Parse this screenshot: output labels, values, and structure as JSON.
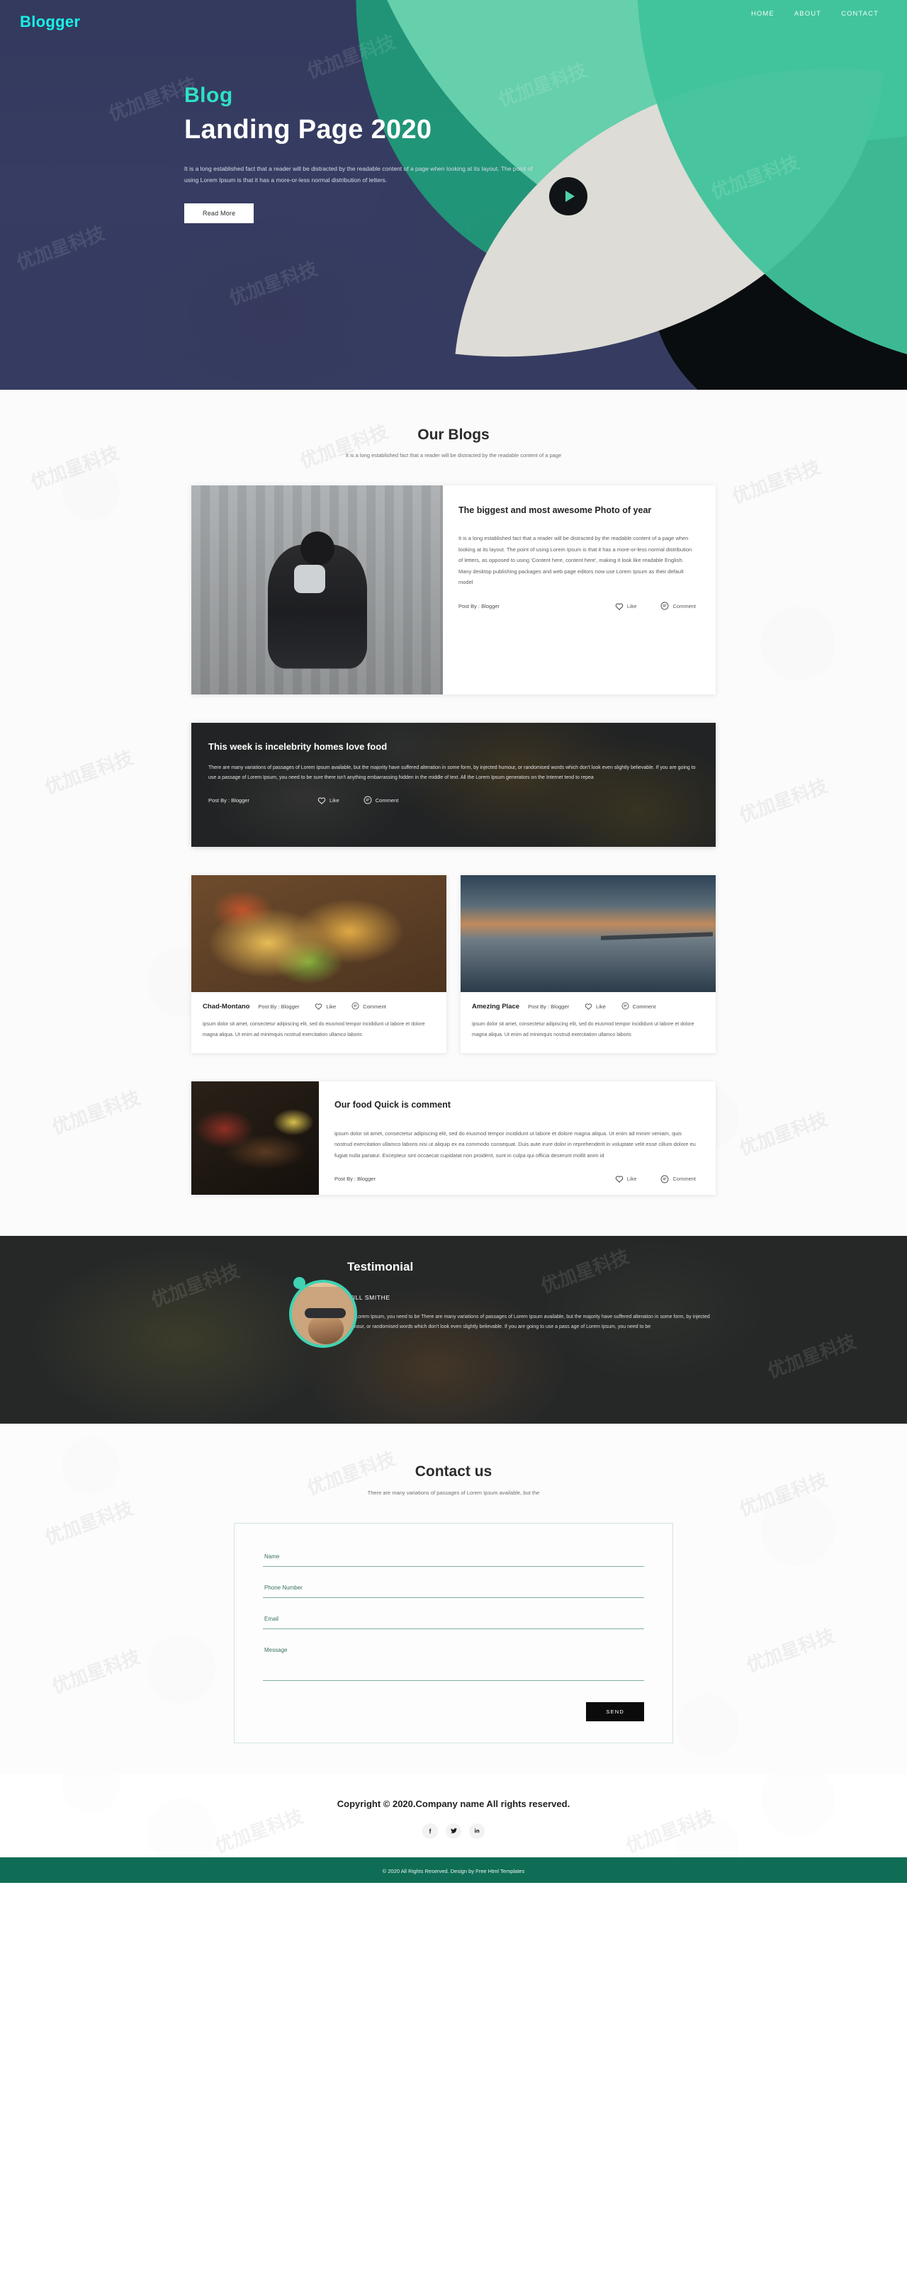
{
  "colors": {
    "accent_teal": "#3fc39b",
    "hero_bg": "#343a5e",
    "brand_cyan": "#18f0e8",
    "footer_green": "#0f6d56"
  },
  "header": {
    "brand": "Blogger",
    "nav": [
      {
        "label": "HOME"
      },
      {
        "label": "ABOUT"
      },
      {
        "label": "CONTACT"
      }
    ]
  },
  "hero": {
    "kicker": "Blog",
    "title": "Landing Page 2020",
    "description": "It is a long established fact that a reader will be distracted by the readable content of a page when looking at its layout. The point of using Lorem Ipsum is that it has a more-or-less normal distribution of letters.",
    "read_more": "Read More",
    "play_icon": "play-icon"
  },
  "blogs": {
    "title": "Our Blogs",
    "subtitle": "It is a long established fact that a reader will be distracted by the readable content of a page",
    "post_by": "Post By : Blogger",
    "like": "Like",
    "comment": "Comment",
    "cards": [
      {
        "title": "The biggest and most awesome Photo of year",
        "text": "It is a long established fact that a reader will be distracted by the readable content of a page when looking at its layout. The point of using Lorem Ipsum is that it has a more-or-less normal distribution of letters, as opposed to using 'Content here, content here', making it look like readable English. Many desktop publishing packages and web page editors now use Lorem Ipsum as their default model"
      },
      {
        "title": "This week is incelebrity homes love food",
        "text": "There are many variations of passages of Lorem Ipsum available, but the majority have suffered alteration in some form, by injected humour, or randomised words which don't look even slightly believable. If you are going to use a passage of Lorem Ipsum, you need to be sure there isn't anything embarrassing hidden in the middle of text. All the Lorem Ipsum generators on the Internet tend to repea"
      },
      {
        "name": "Chad-Montano",
        "text": "ipsum dolor sit amet, consectetur adipiscing elit, sed do eiusmod tempor incididunt ut labore et dolore magna aliqua. Ut enim ad minimquis nostrud exercitation ullamco laboris"
      },
      {
        "name": "Amezing Place",
        "text": "ipsum dolor sit amet, consectetur adipiscing elit, sed do eiusmod tempor incididunt ut labore et dolore magna aliqua. Ut enim ad minimquis nostrud exercitation ullamco laboris"
      },
      {
        "title": "Our food Quick is comment",
        "text": "ipsum dolor sit amet, consectetur adipiscing elit, sed do eiusmod tempor incididunt ut labore et dolore magna aliqua. Ut enim ad minim veniam, quis nostrud exercitation ullamco laboris nisi ut aliquip ex ea commodo consequat. Duis aute irure dolor in reprehenderit in voluptate velit esse cillum dolore eu fugiat nulla pariatur. Excepteur sint occaecat cupidatat non proident, sunt in culpa qui officia deserunt mollit anim id"
      }
    ]
  },
  "testimonial": {
    "title": "Testimonial",
    "name": "WILL SMITHE",
    "text": "Tof Lorem Ipsum, you need to be There are many variations of passages of Lorem Ipsum available, but the majority have suffered alteration in some form, by injected humour, or randomised words which don't look even slightly believable. If you are going to use a pass age of Lorem Ipsum, you need to be"
  },
  "contact": {
    "title": "Contact us",
    "subtitle": "There are many variations of passages of Lorem Ipsum available, but the",
    "fields": {
      "name_placeholder": "Name",
      "phone_placeholder": "Phone Number",
      "email_placeholder": "Email",
      "message_placeholder": "Message",
      "name_value": "",
      "phone_value": "",
      "email_value": "",
      "message_value": ""
    },
    "send_label": "SEND"
  },
  "footer": {
    "copyright": "Copyright © 2020.Company name All rights reserved.",
    "socials": [
      {
        "name": "facebook-icon"
      },
      {
        "name": "twitter-icon"
      },
      {
        "name": "linkedin-icon"
      }
    ],
    "bottom_bar": "© 2020 All Rights Reserved. Design by Free Html Templates"
  },
  "watermark": "优加星科技"
}
